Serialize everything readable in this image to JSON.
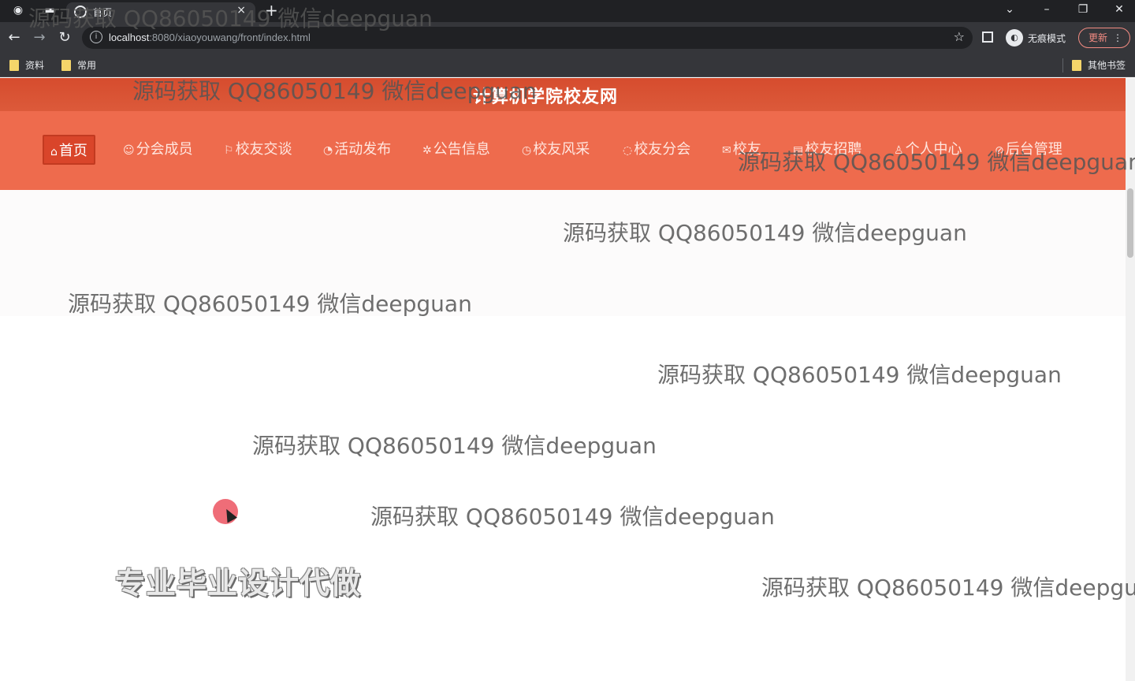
{
  "browser": {
    "tab_title": "首页",
    "url_host": "localhost",
    "url_path": ":8080/xiaoyouwang/front/index.html",
    "profile_label": "无痕模式",
    "update_label": "更新",
    "bookmarks": [
      "资料",
      "常用"
    ],
    "other_bookmarks": "其他书签"
  },
  "site": {
    "title": "计算机学院校友网",
    "nav": [
      {
        "label": "首页",
        "icon": "home-icon",
        "active": true
      },
      {
        "label": "分会成员",
        "icon": "users-icon"
      },
      {
        "label": "校友交谈",
        "icon": "flag-icon"
      },
      {
        "label": "活动发布",
        "icon": "activity-icon"
      },
      {
        "label": "公告信息",
        "icon": "bell-icon"
      },
      {
        "label": "校友风采",
        "icon": "clock-icon"
      },
      {
        "label": "校友分会",
        "icon": "group-icon"
      },
      {
        "label": "校友",
        "icon": "mail-icon"
      },
      {
        "label": "校友招聘",
        "icon": "briefcase-icon"
      },
      {
        "label": "个人中心",
        "icon": "user-icon"
      },
      {
        "label": "后台管理",
        "icon": "link-icon"
      }
    ],
    "slogan": "专业毕业设计代做"
  },
  "watermark": "源码获取 QQ86050149 微信deepguan"
}
